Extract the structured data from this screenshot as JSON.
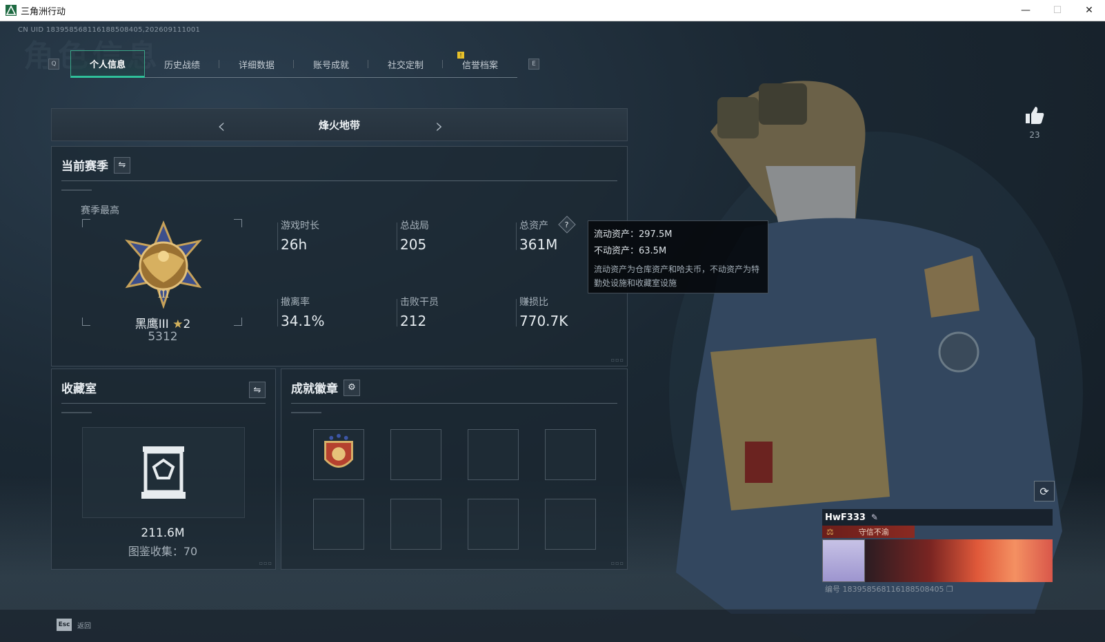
{
  "window": {
    "title": "三角洲行动",
    "min": "—",
    "max": "☐",
    "close": "✕"
  },
  "uid_line": "CN UID 183958568116188508405,202609111001",
  "bg_title": "角色信息",
  "tabs": {
    "left_key": "Q",
    "right_key": "E",
    "items": [
      {
        "label": "个人信息",
        "active": true
      },
      {
        "label": "历史战绩",
        "active": false
      },
      {
        "label": "详细数据",
        "active": false
      },
      {
        "label": "账号成就",
        "active": false
      },
      {
        "label": "社交定制",
        "active": false
      },
      {
        "label": "信誉档案",
        "active": false
      }
    ],
    "notif": "!"
  },
  "mode": {
    "name": "烽火地带",
    "prev": "‹",
    "next": "›"
  },
  "season": {
    "title": "当前赛季",
    "swap_icon": "⇋",
    "peak_label": "赛季最高",
    "rank_name": "黑鹰III",
    "rank_stars": "2",
    "rank_score": "5312",
    "stats": [
      {
        "label": "游戏时长",
        "value": "26h"
      },
      {
        "label": "总战局",
        "value": "205"
      },
      {
        "label": "总资产",
        "value": "361M",
        "help": "?"
      },
      {
        "label": "撤离率",
        "value": "34.1%"
      },
      {
        "label": "击败干员",
        "value": "212"
      },
      {
        "label": "赚损比",
        "value": "770.7K"
      }
    ]
  },
  "tooltip": {
    "liquid": "流动资产：297.5M",
    "fixed": "不动资产：63.5M",
    "desc": "流动资产为仓库资产和哈夫币，不动资产为特勤处设施和收藏室设施"
  },
  "vault": {
    "title": "收藏室",
    "swap_icon": "⇋",
    "total": "211.6M",
    "collection": "图鉴收集：70"
  },
  "badges": {
    "title": "成就徽章",
    "gear_icon": "⚙"
  },
  "likes": {
    "count": "23"
  },
  "player_card": {
    "name": "HwF333",
    "tag": "守信不渝",
    "id_line": "编号 183958568116188508405"
  },
  "footer": {
    "esc_key": "Esc",
    "esc_label": "返回"
  },
  "colors": {
    "accent": "#2fc09a",
    "notif": "#e6c02a",
    "tag": "#8a2a22"
  }
}
